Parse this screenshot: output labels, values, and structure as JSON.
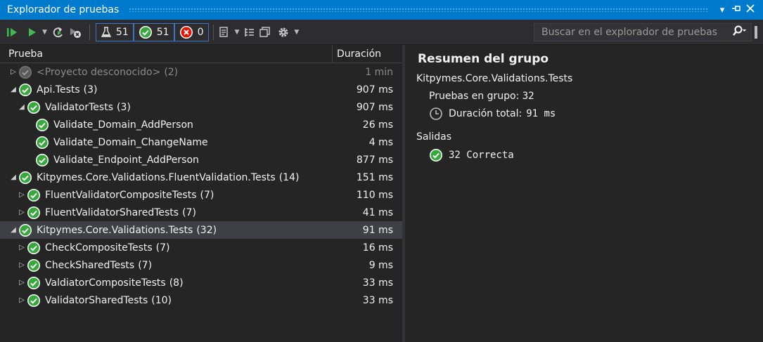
{
  "window": {
    "title": "Explorador de pruebas"
  },
  "toolbar": {
    "counters": {
      "total": "51",
      "passed": "51",
      "failed": "0"
    },
    "search_placeholder": "Buscar en el explorador de pruebas"
  },
  "tree": {
    "col_test": "Prueba",
    "col_duration": "Duración",
    "rows": [
      {
        "name": "<Proyecto desconocido>",
        "count": "(2)",
        "duration": "1 min"
      },
      {
        "name": "Api.Tests",
        "count": "(3)",
        "duration": "907 ms"
      },
      {
        "name": "ValidatorTests",
        "count": "(3)",
        "duration": "907 ms"
      },
      {
        "name": "Validate_Domain_AddPerson",
        "count": "",
        "duration": "26 ms"
      },
      {
        "name": "Validate_Domain_ChangeName",
        "count": "",
        "duration": "4 ms"
      },
      {
        "name": "Validate_Endpoint_AddPerson",
        "count": "",
        "duration": "877 ms"
      },
      {
        "name": "Kitpymes.Core.Validations.FluentValidation.Tests",
        "count": "(14)",
        "duration": "151 ms"
      },
      {
        "name": "FluentValidatorCompositeTests",
        "count": "(7)",
        "duration": "110 ms"
      },
      {
        "name": "FluentValidatorSharedTests",
        "count": "(7)",
        "duration": "41 ms"
      },
      {
        "name": "Kitpymes.Core.Validations.Tests",
        "count": "(32)",
        "duration": "91 ms"
      },
      {
        "name": "CheckCompositeTests",
        "count": "(7)",
        "duration": "16 ms"
      },
      {
        "name": "CheckSharedTests",
        "count": "(7)",
        "duration": "9 ms"
      },
      {
        "name": "ValdiatorCompositeTests",
        "count": "(8)",
        "duration": "33 ms"
      },
      {
        "name": "ValidatorSharedTests",
        "count": "(10)",
        "duration": "33 ms"
      }
    ]
  },
  "summary": {
    "heading": "Resumen del grupo",
    "group": "Kitpymes.Core.Validations.Tests",
    "tests_label": "Pruebas en grupo:",
    "tests_value": "32",
    "duration_label": "Duración total:",
    "duration_value": "91 ms",
    "outputs_label": "Salidas",
    "passed_text": "32 Correcta"
  },
  "colors": {
    "accent": "#007acc",
    "pass": "#37a93c",
    "fail": "#e51400"
  }
}
